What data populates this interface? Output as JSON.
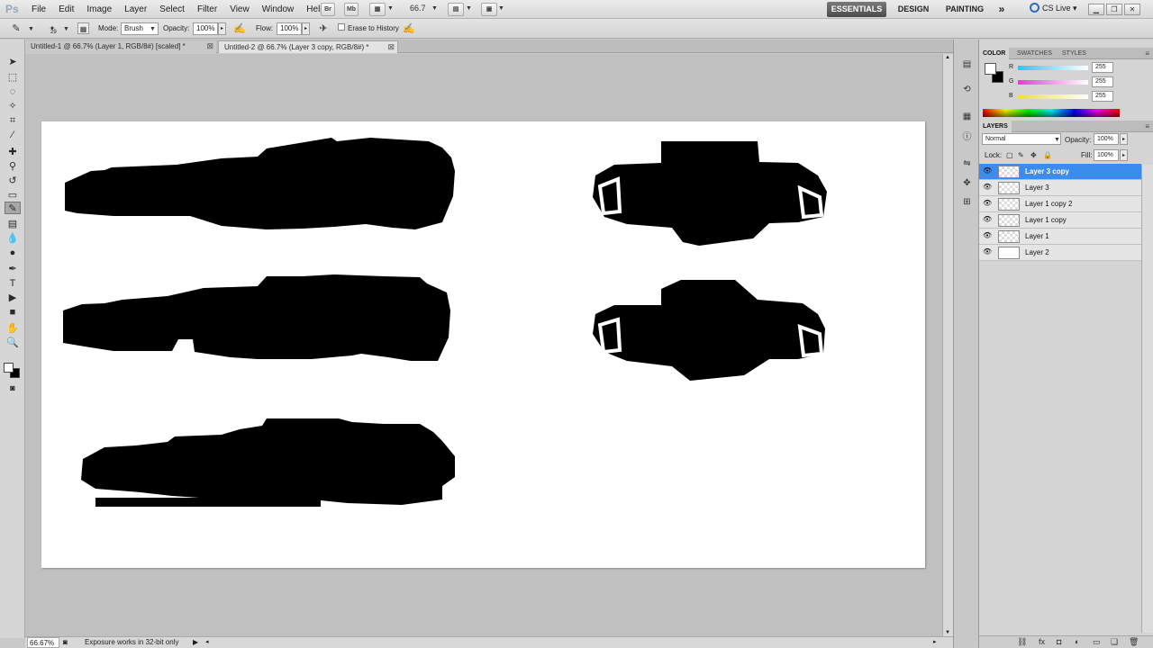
{
  "app": {
    "logo": "Ps"
  },
  "menu": [
    "File",
    "Edit",
    "Image",
    "Layer",
    "Select",
    "Filter",
    "View",
    "Window",
    "Help"
  ],
  "menubar_buttons": {
    "bridge": "Br",
    "minibridge": "Mb",
    "zoom": "66.7"
  },
  "workspaces": {
    "essentials": "ESSENTIALS",
    "design": "DESIGN",
    "painting": "PAINTING",
    "more": "»"
  },
  "cslive": "CS Live",
  "options": {
    "brush_size": "29",
    "mode_label": "Mode:",
    "mode_value": "Brush",
    "opacity_label": "Opacity:",
    "opacity_value": "100%",
    "flow_label": "Flow:",
    "flow_value": "100%",
    "erase_history": "Erase to History"
  },
  "tabs": [
    {
      "label": "Untitled-1 @ 66.7% (Layer 1, RGB/8#) [scaled] *",
      "active": false
    },
    {
      "label": "Untitled-2 @ 66.7% (Layer 3 copy, RGB/8#) *",
      "active": true
    }
  ],
  "status": {
    "zoom": "66.67%",
    "message": "Exposure works in 32-bit only"
  },
  "color_panel": {
    "tabs": [
      "COLOR",
      "SWATCHES",
      "STYLES"
    ],
    "channels": [
      {
        "label": "R",
        "value": "255",
        "color": "#33c4e6"
      },
      {
        "label": "G",
        "value": "255",
        "color": "#e63cc8"
      },
      {
        "label": "B",
        "value": "255",
        "color": "#e8e23a"
      }
    ]
  },
  "layers_panel": {
    "title": "LAYERS",
    "blend_mode": "Normal",
    "opacity_label": "Opacity:",
    "opacity_value": "100%",
    "lock_label": "Lock:",
    "fill_label": "Fill:",
    "fill_value": "100%",
    "layers": [
      {
        "name": "Layer 3 copy",
        "selected": true
      },
      {
        "name": "Layer 3",
        "selected": false
      },
      {
        "name": "Layer 1 copy 2",
        "selected": false
      },
      {
        "name": "Layer 1 copy",
        "selected": false
      },
      {
        "name": "Layer 1",
        "selected": false
      },
      {
        "name": "Layer 2",
        "selected": false
      }
    ]
  },
  "colors": {
    "accent": "#3c8cf0",
    "canvas": "#ffffff",
    "workspace": "#c0c0c0"
  }
}
